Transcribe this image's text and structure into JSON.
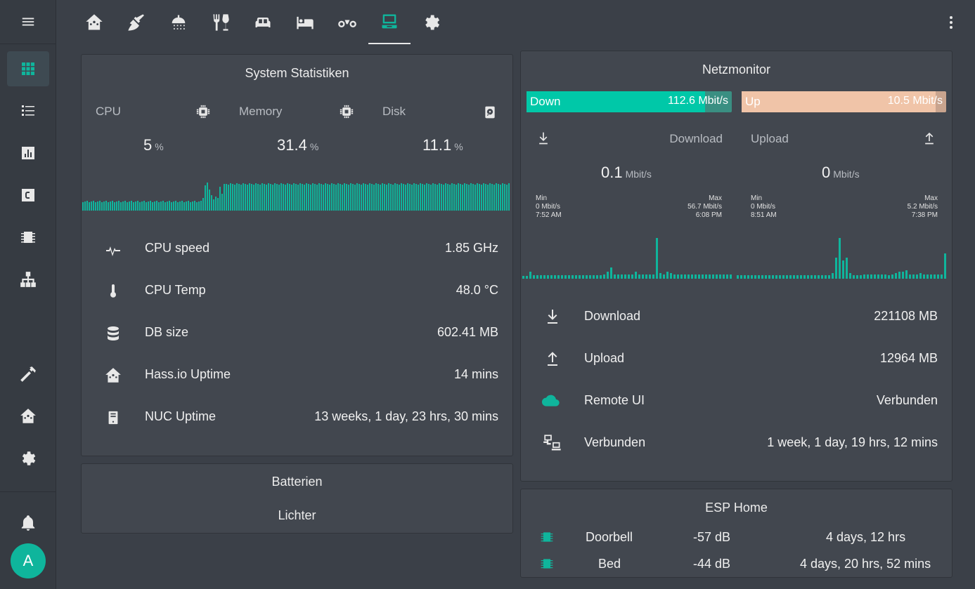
{
  "tabs": [
    {
      "icon": "home-assistant-icon"
    },
    {
      "icon": "broom-icon"
    },
    {
      "icon": "shower-icon"
    },
    {
      "icon": "silverware-icon"
    },
    {
      "icon": "sofa-icon"
    },
    {
      "icon": "bed-icon"
    },
    {
      "icon": "bicycle-icon"
    },
    {
      "icon": "laptop-icon",
      "active": true
    },
    {
      "icon": "gear-icon"
    }
  ],
  "sidebar": {
    "items": [
      "view-grid-icon",
      "format-list-icon",
      "chart-bar-icon",
      "alpha-c-box-icon",
      "memory-chip-icon",
      "sitemap-icon",
      "hammer-icon",
      "home-assistant-icon",
      "gear-icon",
      "bell-icon"
    ],
    "avatar_letter": "A"
  },
  "system": {
    "title": "System Statistiken",
    "cpu_label": "CPU",
    "memory_label": "Memory",
    "disk_label": "Disk",
    "cpu_value": "5",
    "memory_value": "31.4",
    "disk_value": "11.1",
    "unit": "%",
    "rows": [
      {
        "label": "CPU speed",
        "value": "1.85 GHz",
        "icon": "pulse-icon"
      },
      {
        "label": "CPU Temp",
        "value": "48.0 °C",
        "icon": "thermometer-icon"
      },
      {
        "label": "DB size",
        "value": "602.41 MB",
        "icon": "database-icon"
      },
      {
        "label": "Hass.io Uptime",
        "value": "14 mins",
        "icon": "home-assistant-icon"
      },
      {
        "label": "NUC Uptime",
        "value": "13 weeks, 1 day, 23 hrs, 30 mins",
        "icon": "server-icon"
      }
    ]
  },
  "batterien": {
    "title": "Batterien",
    "subtitle": "Lichter"
  },
  "netz": {
    "title": "Netzmonitor",
    "down_label": "Down",
    "down_value": "112.6 Mbit/s",
    "down_fill": 0.87,
    "up_label": "Up",
    "up_value": "10.5 Mbit/s",
    "up_fill": 0.95,
    "download_label": "Download",
    "upload_label": "Upload",
    "download_value": "0.1",
    "upload_value": "0",
    "rate_unit": "Mbit/s",
    "dl_min_label": "Min",
    "dl_min_value": "0 Mbit/s",
    "dl_min_time": "7:52 AM",
    "dl_max_label": "Max",
    "dl_max_value": "56.7 Mbit/s",
    "dl_max_time": "6:08 PM",
    "ul_min_label": "Min",
    "ul_min_value": "0 Mbit/s",
    "ul_min_time": "8:51 AM",
    "ul_max_label": "Max",
    "ul_max_value": "5.2 Mbit/s",
    "ul_max_time": "7:38 PM",
    "rows": [
      {
        "label": "Download",
        "value": "221108 MB",
        "icon": "download-icon"
      },
      {
        "label": "Upload",
        "value": "12964 MB",
        "icon": "upload-icon"
      },
      {
        "label": "Remote UI",
        "value": "Verbunden",
        "icon": "cloud-icon"
      },
      {
        "label": "Verbunden",
        "value": "1 week, 1 day, 19 hrs, 12 mins",
        "icon": "lan-connect-icon"
      }
    ]
  },
  "esp": {
    "title": "ESP Home",
    "devices": [
      {
        "name": "Doorbell",
        "signal": "-57 dB",
        "uptime": "4 days, 12 hrs"
      },
      {
        "name": "Bed",
        "signal": "-44 dB",
        "uptime": "4 days, 20 hrs, 52 mins"
      }
    ]
  },
  "colors": {
    "accent": "#0fb59c",
    "down_bar": "#00c8a8",
    "up_bar": "#f0c4a8",
    "card": "#42474f",
    "background": "#3b4048"
  }
}
